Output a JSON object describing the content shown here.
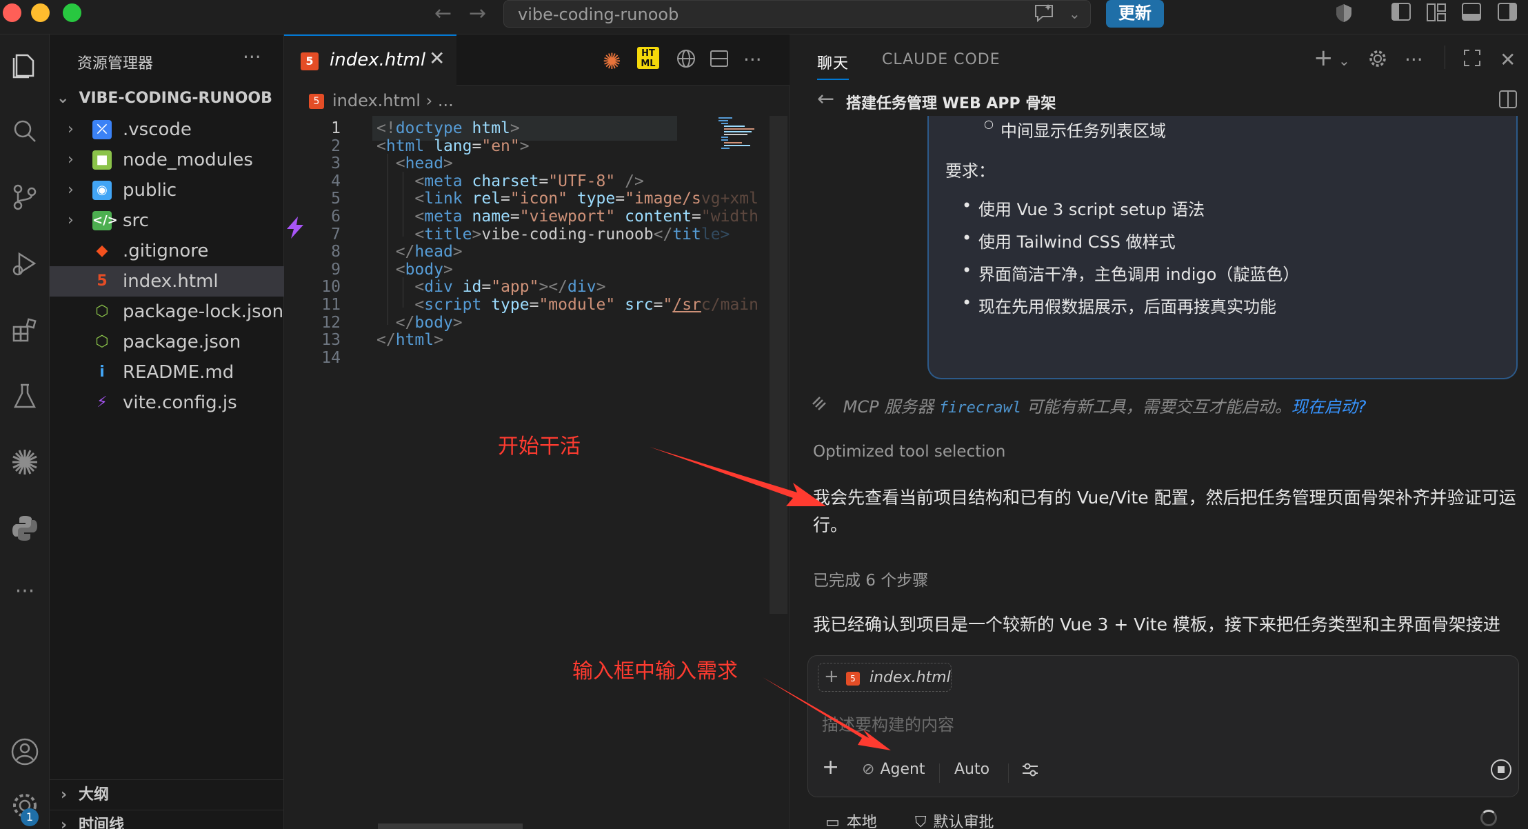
{
  "window": {
    "search_text": "vibe-coding-runoob",
    "update_button": "更新"
  },
  "explorer": {
    "title": "资源管理器",
    "more": "···",
    "root": "VIBE-CODING-RUNOOB",
    "items": [
      {
        "label": ".vscode",
        "kind": "folder",
        "color": "#3b82f6"
      },
      {
        "label": "node_modules",
        "kind": "folder",
        "color": "#8bc34a"
      },
      {
        "label": "public",
        "kind": "folder",
        "color": "#42a5f5"
      },
      {
        "label": "src",
        "kind": "folder",
        "color": "#4caf50"
      },
      {
        "label": ".gitignore",
        "kind": "file",
        "color": "#f4511e"
      },
      {
        "label": "index.html",
        "kind": "file",
        "color": "#e44d26"
      },
      {
        "label": "package-lock.json",
        "kind": "file",
        "color": "#8bc34a"
      },
      {
        "label": "package.json",
        "kind": "file",
        "color": "#8bc34a"
      },
      {
        "label": "README.md",
        "kind": "file",
        "color": "#42a5f5"
      },
      {
        "label": "vite.config.js",
        "kind": "file",
        "color": "#a855f7"
      }
    ],
    "outline": "大纲",
    "timeline": "时间线"
  },
  "activity": {
    "badge": "1"
  },
  "editor": {
    "tab_label": "index.html",
    "breadcrumb_file": "index.html",
    "breadcrumb_rest": "› ...",
    "line_numbers": [
      "1",
      "2",
      "3",
      "4",
      "5",
      "6",
      "7",
      "8",
      "9",
      "10",
      "11",
      "12",
      "13",
      "14"
    ]
  },
  "chat": {
    "tab_chat": "聊天",
    "tab_claude": "CLAUDE CODE",
    "thread_title": "搭建任务管理 WEB APP 骨架",
    "card_sub": "中间显示任务列表区域",
    "card_heading": "要求：",
    "card_bullets": [
      "使用 Vue 3 script setup 语法",
      "使用 Tailwind CSS 做样式",
      "界面简洁干净，主色调用 indigo（靛蓝色）",
      "现在先用假数据展示，后面再接真实功能"
    ],
    "mcp_prefix": "MCP 服务器",
    "mcp_server": "firecrawl",
    "mcp_middle": "可能有新工具，需要交互才能启动。",
    "mcp_link": "现在启动?",
    "optimized": "Optimized tool selection",
    "reply_1": "我会先查看当前项目结构和已有的 Vue/Vite 配置，然后把任务管理页面骨架补齐并验证可运行。",
    "steps": "已完成 6 个步骤",
    "reply_2": "我已经确认到项目是一个较新的 Vue 3 + Vite 模板，接下来把任务类型和主界面骨架接进",
    "input": {
      "chip_label": "index.html",
      "placeholder": "描述要构建的内容",
      "agent": "Agent",
      "auto": "Auto"
    },
    "footer_local": "本地",
    "footer_approve": "默认审批"
  },
  "annotations": {
    "start": "开始干活",
    "input_hint": "输入框中输入需求"
  },
  "colors": {
    "accent": "#0078d4",
    "annotation": "#ff3b30"
  }
}
